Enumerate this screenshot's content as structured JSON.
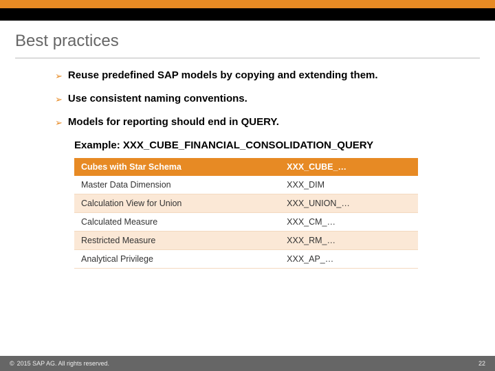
{
  "title": "Best practices",
  "bullets": [
    "Reuse predefined SAP models by copying and extending them.",
    "Use consistent naming conventions.",
    "Models for reporting should end in QUERY."
  ],
  "example": "Example: XXX_CUBE_FINANCIAL_CONSOLIDATION_QUERY",
  "table": {
    "headers": [
      "Cubes with Star Schema",
      "XXX_CUBE_…"
    ],
    "rows": [
      [
        "Master Data Dimension",
        "XXX_DIM"
      ],
      [
        "Calculation View for Union",
        "XXX_UNION_…"
      ],
      [
        "Calculated Measure",
        "XXX_CM_…"
      ],
      [
        "Restricted Measure",
        "XXX_RM_…"
      ],
      [
        "Analytical Privilege",
        "XXX_AP_…"
      ]
    ]
  },
  "footer": {
    "copyright": "2015 SAP AG. All rights reserved.",
    "page": "22"
  },
  "colors": {
    "accent": "#e78a24",
    "footer_bg": "#666666"
  }
}
